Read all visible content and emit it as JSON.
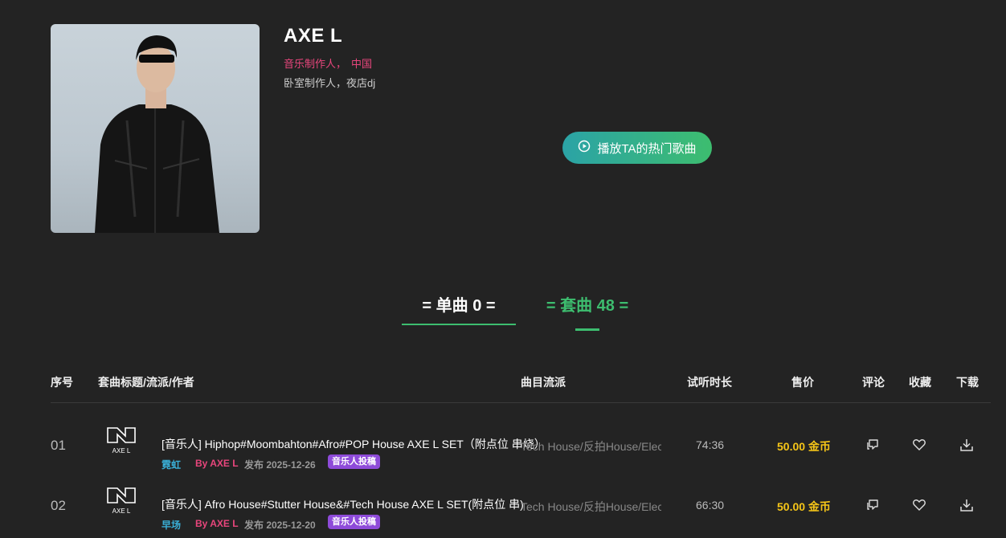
{
  "artist": {
    "name": "AXE L",
    "role": "音乐制作人，",
    "region": "中国",
    "description": "卧室制作人，夜店dj"
  },
  "play_button": {
    "label": "播放TA的热门歌曲",
    "icon": "play-circle-icon"
  },
  "tabs": [
    {
      "label": "= 单曲 0 =",
      "active": true
    },
    {
      "label": "= 套曲 48 =",
      "active": false
    }
  ],
  "table": {
    "headers": {
      "index": "序号",
      "title": "套曲标题/流派/作者",
      "genre": "曲目流派",
      "duration": "试听时长",
      "price": "售价",
      "comment": "评论",
      "favorite": "收藏",
      "download": "下载"
    },
    "rows": [
      {
        "index": "01",
        "title": "[音乐人] Hiphop#Moombahton#Afro#POP House AXE L SET（附点位 串烧）",
        "tag": "霓虹",
        "author": "By AXE L",
        "date": "发布 2025-12-26",
        "badge": "音乐人投稿",
        "genre": "Tech House/反拍House/Elect...",
        "duration": "74:36",
        "price": "50.00 金币",
        "logo_text": "AXE L"
      },
      {
        "index": "02",
        "title": "[音乐人] Afro House#Stutter House&#Tech House AXE L SET(附点位 串)",
        "tag": "早场",
        "author": "By AXE L",
        "date": "发布 2025-12-20",
        "badge": "音乐人投稿",
        "genre": "Tech House/反拍House/Elect...",
        "duration": "66:30",
        "price": "50.00 金币",
        "logo_text": "AXE L"
      }
    ]
  },
  "colors": {
    "accent_green": "#3dbd6f",
    "accent_pink": "#e8467c",
    "price_gold": "#f5c518",
    "badge_purple": "#8e4bd9",
    "tag_blue": "#3ab0d8",
    "background": "#232323"
  }
}
